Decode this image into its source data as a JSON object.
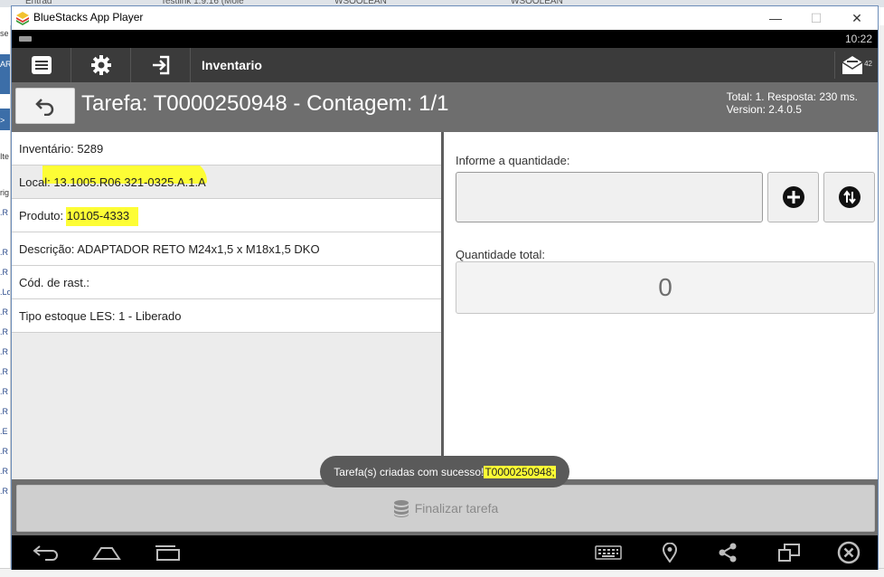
{
  "window": {
    "title": "BlueStacks App Player",
    "minimize_glyph": "—",
    "maximize_glyph": "☐",
    "close_glyph": "✕"
  },
  "status": {
    "time": "10:22"
  },
  "actionbar": {
    "title": "Inventario",
    "inbox_count": "42",
    "menu_icon": "menu-icon",
    "settings_icon": "gear-icon",
    "logout_icon": "logout-icon"
  },
  "task": {
    "title": "Tarefa: T0000250948 - Contagem: 1/1",
    "info_line1": "Total: 1. Resposta: 230 ms.",
    "info_line2": "Version: 2.4.0.5"
  },
  "details": [
    {
      "label": "Inventário: ",
      "value": "5289",
      "highlight": false
    },
    {
      "label": "Loca",
      "value": "l: 13.1005.R06.321-0325.A.1.A",
      "highlight": true
    },
    {
      "label": "Produto: ",
      "value": "10105-4333",
      "highlight": true
    },
    {
      "label": "Descrição: ",
      "value": "ADAPTADOR RETO M24x1,5 x M18x1,5 DKO",
      "highlight": false
    },
    {
      "label": "Cód. de rast.:",
      "value": "",
      "highlight": false
    },
    {
      "label": "Tipo estoque LES: ",
      "value": "1 - Liberado",
      "highlight": false
    }
  ],
  "quantity": {
    "label": "Informe a quantidade:",
    "value": "",
    "total_label": "Quantidade total:",
    "total_value": "0"
  },
  "footer": {
    "finalize_label": "Finalizar tarefa"
  },
  "toast": {
    "text": "Tarefa(s) criadas com sucesso! ",
    "highlight": "T0000250948;"
  },
  "colors": {
    "actionbar": "#3b3b3b",
    "panel": "#6e6e6e",
    "highlight": "#fdfd35"
  },
  "background": {
    "tabs": [
      "Entrad",
      "Testlink 1.9.16 (Mole",
      "WSOOLEAN",
      "WSOOLEAN"
    ],
    "left_column": [
      "se",
      "AR/",
      "",
      ">",
      "Ite",
      "rig",
      ".R",
      ".R",
      ".R",
      ".Lo",
      ".R",
      ".R",
      ".R",
      ".R",
      ".R",
      ".R",
      ".E",
      ".R",
      ".R",
      ".R"
    ]
  }
}
